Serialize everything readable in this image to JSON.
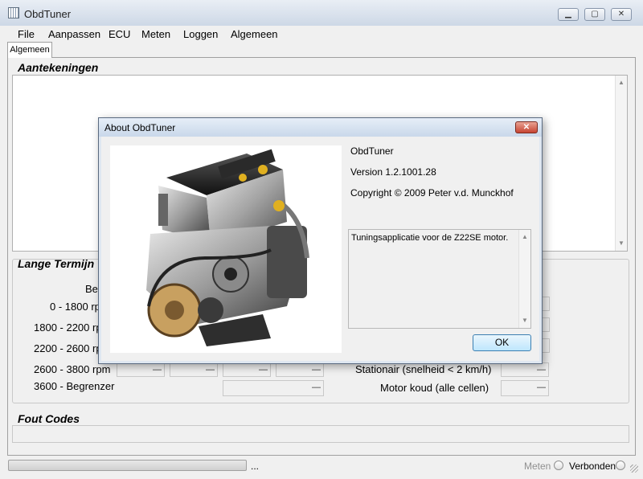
{
  "window": {
    "title": "ObdTuner",
    "minimize_label": "▁",
    "maximize_label": "▢",
    "close_label": "✕"
  },
  "menu": [
    "File",
    "Aanpassen",
    "ECU",
    "Meten",
    "Loggen",
    "Algemeen"
  ],
  "tabs": [
    {
      "label": "Algemeen"
    }
  ],
  "sections": {
    "notes_title": "Aantekeningen",
    "long_term_title": "Lange Termijn",
    "fault_codes_title": "Fout Codes"
  },
  "long_term": {
    "header_partial": "Be",
    "rows": [
      {
        "label": "0 - 1800 rp"
      },
      {
        "label": "1800 - 2200 rp"
      },
      {
        "label": "2200 - 2600 rp"
      },
      {
        "label": "2600 - 3800 rpm"
      },
      {
        "label": "3600 - Begrenzer"
      }
    ],
    "dash": "—",
    "right_rows": [
      {
        "label": "Stationair (snelheid < 2 km/h)"
      },
      {
        "label": "Motor koud (alle cellen)"
      }
    ]
  },
  "status": {
    "progress_suffix": "...",
    "meten_label": "Meten",
    "verbonden_label": "Verbonden"
  },
  "dialog": {
    "title": "About ObdTuner",
    "close_label": "✕",
    "product": "ObdTuner",
    "version": "Version 1.2.1001.28",
    "copyright": "Copyright © 2009 Peter v.d. Munckhof",
    "description": "Tuningsapplicatie voor de Z22SE motor.",
    "ok_label": "OK"
  },
  "colors": {
    "titlebar": "#cdd8e6",
    "dialog_close": "#c64432",
    "ok_button": "#bee6fd",
    "background": "#f0f0f0"
  }
}
